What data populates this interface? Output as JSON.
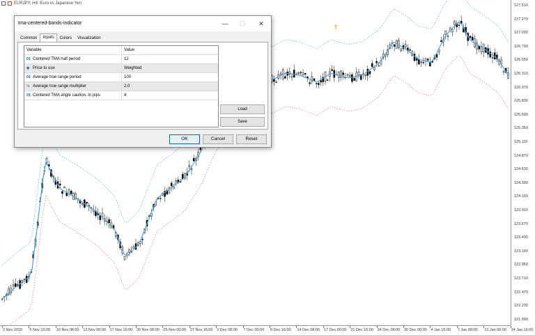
{
  "chart": {
    "symbol_text": "EURJPY, H4:  Euro vs Japanese Yen",
    "price_labels": [
      "127.510",
      "127.270",
      "127.030",
      "126.790",
      "126.550",
      "126.310",
      "126.070",
      "125.830",
      "125.590",
      "125.350",
      "125.110",
      "124.870",
      "124.630",
      "124.390",
      "124.150",
      "123.910",
      "123.670",
      "123.430",
      "123.190",
      "122.950",
      "122.710",
      "122.470",
      "122.230",
      "121.990"
    ],
    "time_labels": [
      "3 Nov 2020",
      "5 Nov 16:00",
      "10 Nov 08:00",
      "13 Nov 00:00",
      "17 Nov 16:00",
      "20 Nov 08:00",
      "25 Nov 00:00",
      "27 Nov 16:00",
      "2 Dec 08:00",
      "7 Dec 00:00",
      "9 Dec 16:00",
      "14 Dec 08:00",
      "17 Dec 00:00",
      "21 Dec 16:00",
      "24 Dec 08:00",
      "30 Dec 00:00",
      "4 Jan 16:00",
      "7 Jan 08:00",
      "12 Jan 00:00",
      "14 Jan 16:00"
    ],
    "colors": {
      "up": "#000000",
      "down": "#000000",
      "tma": "#4aa3e8",
      "tma_down": "#e86a6a",
      "band_upper": "#4aa3e8",
      "band_lower": "#e86a6a"
    },
    "arrow_icon": "up-arrow-marker-icon"
  },
  "dialog": {
    "title": "tma-centered-bands-indicator",
    "controls": {
      "minimize": "—",
      "maximize": "☐",
      "close": "✕"
    },
    "tabs": [
      "Common",
      "Inputs",
      "Colors",
      "Visualization"
    ],
    "active_tab": "Inputs",
    "grid": {
      "headers": {
        "variable": "Variable",
        "value": "Value"
      },
      "rows": [
        {
          "icon": "01",
          "variable": "Centered TMA half period",
          "value": "12"
        },
        {
          "icon": "◈",
          "variable": "Price to use",
          "value": "Weighted"
        },
        {
          "icon": "01",
          "variable": "Average true range period",
          "value": "100"
        },
        {
          "icon": "½",
          "variable": "Average true range multiplier",
          "value": "2.0"
        },
        {
          "icon": "01",
          "variable": "Centered TMA angle caution. In pips",
          "value": "4"
        }
      ]
    },
    "buttons": {
      "load": "Load",
      "save": "Save",
      "ok": "OK",
      "cancel": "Cancel",
      "reset": "Reset"
    }
  }
}
